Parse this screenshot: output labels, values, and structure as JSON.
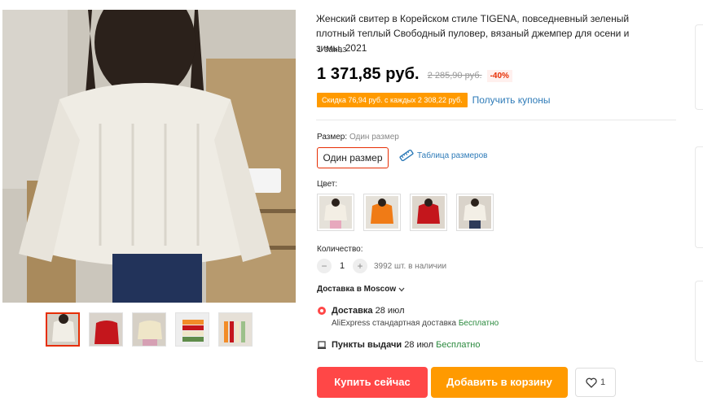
{
  "product": {
    "title": "Женский свитер в Корейском стиле TIGENA, повседневный зеленый плотный теплый Свободный пуловер, вязаный джемпер для осени и зимы, 2021",
    "orders": "1 заказ",
    "price": "1 371,85 руб.",
    "old_price": "2 285,90 руб.",
    "discount": "-40%",
    "coupon_text": "Скидка 76,94 руб. с каждых 2 308,22 руб.",
    "coupon_link": "Получить купоны"
  },
  "size": {
    "label": "Размер:",
    "selected": "Один размер",
    "option": "Один размер",
    "table_link": "Таблица размеров"
  },
  "color": {
    "label": "Цвет:",
    "options": [
      "beige-icon",
      "orange-icon",
      "red-icon",
      "cream-icon"
    ]
  },
  "quantity": {
    "label": "Количество:",
    "minus": "−",
    "value": "1",
    "plus": "+",
    "stock": "3992 шт. в наличии"
  },
  "shipping": {
    "ship_to": "Доставка в Moscow",
    "delivery_label": "Доставка",
    "delivery_date": "28 июл",
    "delivery_service": "AliExpress стандартная доставка",
    "delivery_price": "Бесплатно",
    "pickup_label": "Пункты выдачи",
    "pickup_date": "28 июл",
    "pickup_price": "Бесплатно"
  },
  "actions": {
    "buy_now": "Купить сейчас",
    "add_to_cart": "Добавить в корзину",
    "wishlist_count": "1"
  },
  "colors": {
    "accent_red": "#e62e04",
    "buy_red": "#ff4747",
    "orange": "#ff9a00",
    "link_blue": "#2e7bb8",
    "free_green": "#2b8a3e"
  }
}
